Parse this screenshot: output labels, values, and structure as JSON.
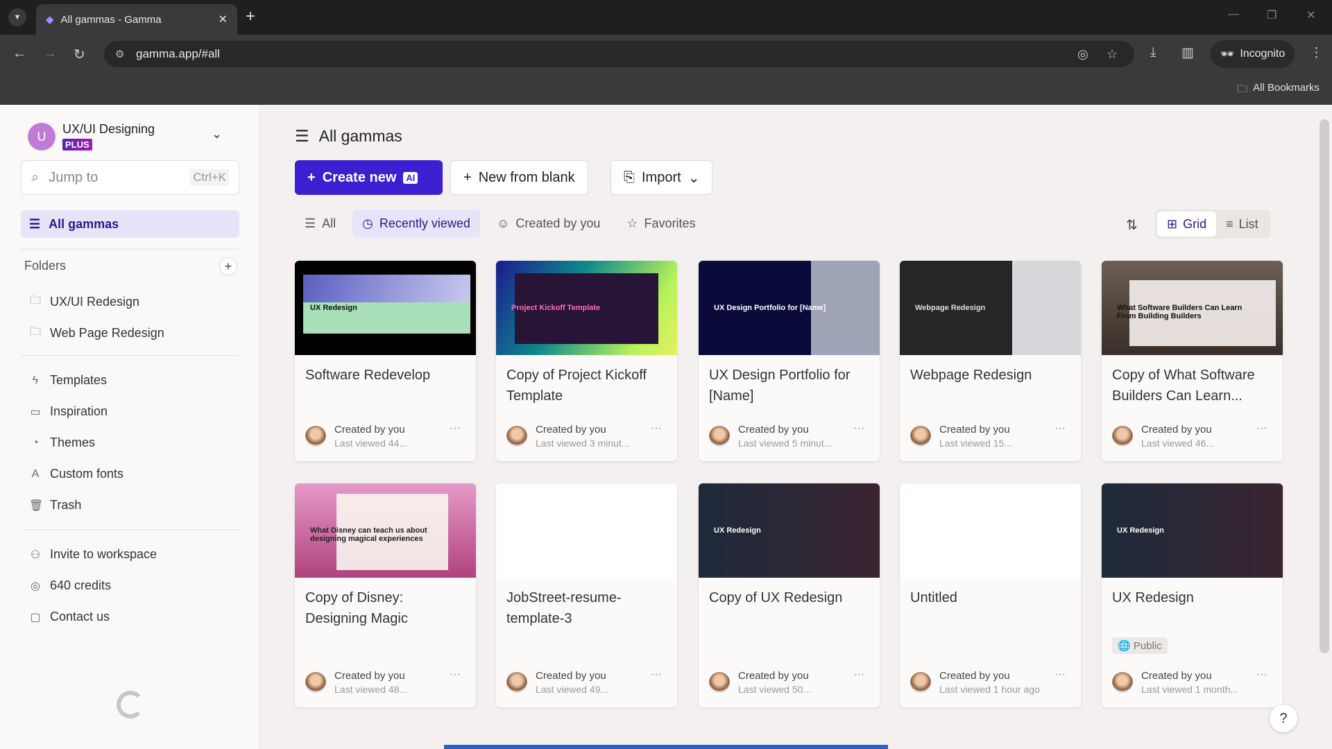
{
  "browser": {
    "tab_title": "All gammas - Gamma",
    "url": "gamma.app/#all",
    "incognito_label": "Incognito",
    "bookmarks_label": "All Bookmarks"
  },
  "sidebar": {
    "workspace_initial": "U",
    "workspace_name": "UX/UI Designing",
    "plan_badge": "PLUS",
    "search_placeholder": "Jump to",
    "search_shortcut": "Ctrl+K",
    "active_item": "All gammas",
    "folders_label": "Folders",
    "folders": [
      "UX/UI Redesign",
      "Web Page Redesign"
    ],
    "items": [
      "Templates",
      "Inspiration",
      "Themes",
      "Custom fonts",
      "Trash"
    ],
    "bottom_items": [
      "Invite to workspace",
      "640 credits",
      "Contact us"
    ]
  },
  "main": {
    "title": "All gammas",
    "create_new": "Create new",
    "ai_badge": "AI",
    "new_from_blank": "New from blank",
    "import": "Import",
    "filters": [
      "All",
      "Recently viewed",
      "Created by you",
      "Favorites"
    ],
    "view_grid": "Grid",
    "view_list": "List",
    "cards": [
      {
        "title": "Software Redevelop",
        "created": "Created by you",
        "viewed": "Last viewed 44...",
        "thumb_text": "UX Redesign"
      },
      {
        "title": "Copy of Project Kickoff Template",
        "created": "Created by you",
        "viewed": "Last viewed 3 minut...",
        "thumb_text": "Project Kickoff Template"
      },
      {
        "title": "UX Design Portfolio for [Name]",
        "created": "Created by you",
        "viewed": "Last viewed 5 minut...",
        "thumb_text": "UX Design Portfolio for [Name]"
      },
      {
        "title": "Webpage Redesign",
        "created": "Created by you",
        "viewed": "Last viewed 15...",
        "thumb_text": "Webpage Redesign"
      },
      {
        "title": "Copy of What Software Builders Can Learn...",
        "created": "Created by you",
        "viewed": "Last viewed 46...",
        "thumb_text": "What Software Builders Can Learn From Building Builders"
      },
      {
        "title": "Copy of Disney: Designing Magic",
        "created": "Created by you",
        "viewed": "Last viewed 48...",
        "thumb_text": "What Disney can teach us about designing magical experiences"
      },
      {
        "title": "JobStreet-resume-template-3",
        "created": "Created by you",
        "viewed": "Last viewed 49...",
        "thumb_text": ""
      },
      {
        "title": "Copy of UX Redesign",
        "created": "Created by you",
        "viewed": "Last viewed 50...",
        "thumb_text": "UX Redesign"
      },
      {
        "title": "Untitled",
        "created": "Created by you",
        "viewed": "Last viewed 1 hour ago",
        "thumb_text": ""
      },
      {
        "title": "UX Redesign",
        "created": "Created by you",
        "viewed": "Last viewed 1 month...",
        "thumb_text": "UX Redesign",
        "badge": "Public"
      }
    ]
  },
  "colors": {
    "accent": "#3c1fd1",
    "active_bg": "#e7e3f8"
  }
}
